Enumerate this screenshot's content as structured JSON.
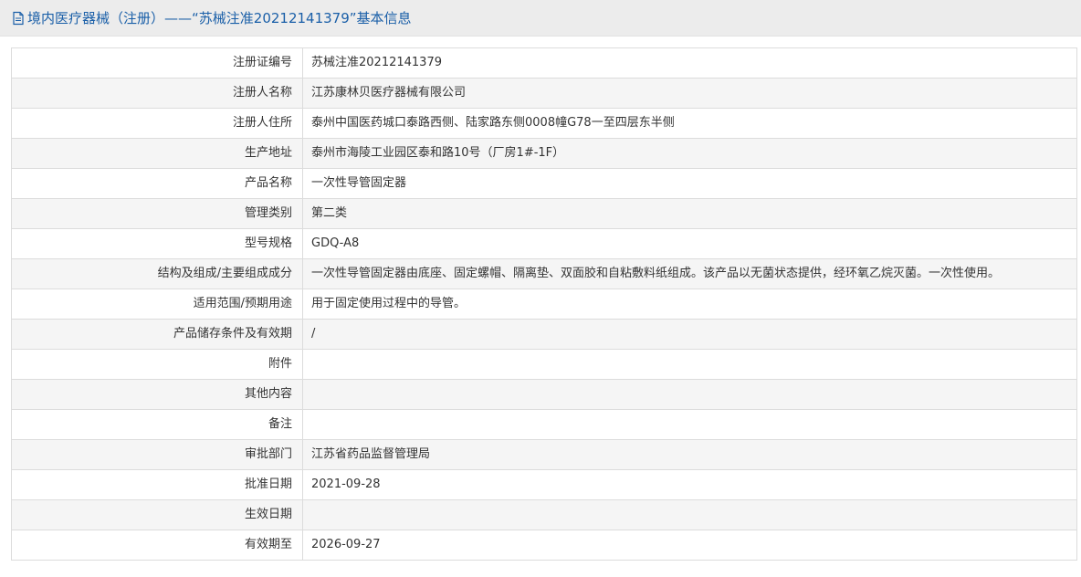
{
  "header": {
    "icon": "document-icon",
    "title": "境内医疗器械（注册）——“苏械注准20212141379”基本信息",
    "title_color": "#1a5fa8",
    "background": "#ececec"
  },
  "record": {
    "rows": [
      {
        "label": "注册证编号",
        "value": "苏械注准20212141379"
      },
      {
        "label": "注册人名称",
        "value": "江苏康林贝医疗器械有限公司"
      },
      {
        "label": "注册人住所",
        "value": "泰州中国医药城口泰路西侧、陆家路东侧0008幢G78一至四层东半侧"
      },
      {
        "label": "生产地址",
        "value": "泰州市海陵工业园区泰和路10号（厂房1#-1F）"
      },
      {
        "label": "产品名称",
        "value": "一次性导管固定器"
      },
      {
        "label": "管理类别",
        "value": "第二类"
      },
      {
        "label": "型号规格",
        "value": "GDQ-A8"
      },
      {
        "label": "结构及组成/主要组成成分",
        "value": "一次性导管固定器由底座、固定螺帽、隔离垫、双面胶和自粘敷料纸组成。该产品以无菌状态提供，经环氧乙烷灭菌。一次性使用。"
      },
      {
        "label": "适用范围/预期用途",
        "value": "用于固定使用过程中的导管。"
      },
      {
        "label": "产品储存条件及有效期",
        "value": "/"
      },
      {
        "label": "附件",
        "value": ""
      },
      {
        "label": "其他内容",
        "value": ""
      },
      {
        "label": "备注",
        "value": ""
      },
      {
        "label": "审批部门",
        "value": "江苏省药品监督管理局"
      },
      {
        "label": "批准日期",
        "value": "2021-09-28"
      },
      {
        "label": "生效日期",
        "value": ""
      },
      {
        "label": "有效期至",
        "value": "2026-09-27"
      }
    ]
  }
}
